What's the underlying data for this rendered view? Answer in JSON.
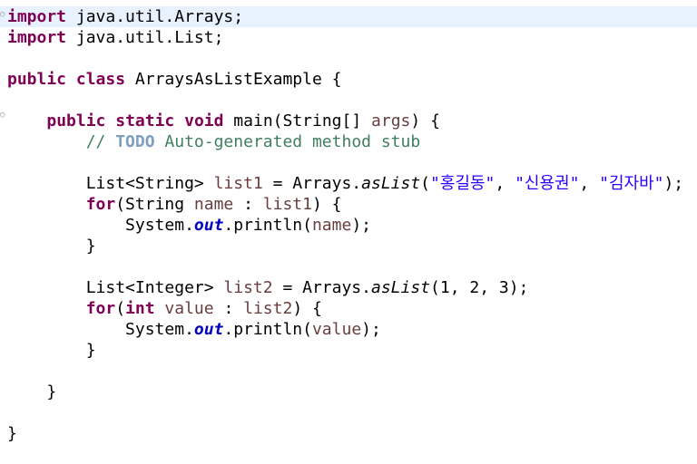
{
  "editor": {
    "lines": [
      {
        "tokens": [
          {
            "t": "kw",
            "v": "import"
          },
          {
            "t": "pl",
            "v": " java.util.Arrays;"
          }
        ]
      },
      {
        "tokens": [
          {
            "t": "kw",
            "v": "import"
          },
          {
            "t": "pl",
            "v": " java.util.List;"
          }
        ]
      },
      {
        "tokens": []
      },
      {
        "tokens": [
          {
            "t": "kw",
            "v": "public"
          },
          {
            "t": "pl",
            "v": " "
          },
          {
            "t": "kw",
            "v": "class"
          },
          {
            "t": "pl",
            "v": " ArraysAsListExample {"
          }
        ]
      },
      {
        "tokens": []
      },
      {
        "tokens": [
          {
            "t": "pl",
            "v": "    "
          },
          {
            "t": "kw",
            "v": "public"
          },
          {
            "t": "pl",
            "v": " "
          },
          {
            "t": "kw",
            "v": "static"
          },
          {
            "t": "pl",
            "v": " "
          },
          {
            "t": "kw",
            "v": "void"
          },
          {
            "t": "pl",
            "v": " main(String[] "
          },
          {
            "t": "var",
            "v": "args"
          },
          {
            "t": "pl",
            "v": ") {"
          }
        ]
      },
      {
        "tokens": [
          {
            "t": "cmt",
            "v": "        // "
          },
          {
            "t": "todo",
            "v": "TODO"
          },
          {
            "t": "cmt",
            "v": " Auto-generated method stub"
          }
        ]
      },
      {
        "tokens": []
      },
      {
        "tokens": [
          {
            "t": "pl",
            "v": "        List<String> "
          },
          {
            "t": "var",
            "v": "list1"
          },
          {
            "t": "pl",
            "v": " = Arrays."
          },
          {
            "t": "stm",
            "v": "asList"
          },
          {
            "t": "pl",
            "v": "("
          },
          {
            "t": "str",
            "v": "\"홍길동\""
          },
          {
            "t": "pl",
            "v": ", "
          },
          {
            "t": "str",
            "v": "\"신용권\""
          },
          {
            "t": "pl",
            "v": ", "
          },
          {
            "t": "str",
            "v": "\"김자바\""
          },
          {
            "t": "pl",
            "v": ");"
          }
        ]
      },
      {
        "tokens": [
          {
            "t": "pl",
            "v": "        "
          },
          {
            "t": "kw",
            "v": "for"
          },
          {
            "t": "pl",
            "v": "(String "
          },
          {
            "t": "var",
            "v": "name"
          },
          {
            "t": "pl",
            "v": " : "
          },
          {
            "t": "var",
            "v": "list1"
          },
          {
            "t": "pl",
            "v": ") {"
          }
        ]
      },
      {
        "tokens": [
          {
            "t": "pl",
            "v": "            System."
          },
          {
            "t": "fld",
            "v": "out"
          },
          {
            "t": "pl",
            "v": ".println("
          },
          {
            "t": "var",
            "v": "name"
          },
          {
            "t": "pl",
            "v": ");"
          }
        ]
      },
      {
        "tokens": [
          {
            "t": "pl",
            "v": "        }"
          }
        ]
      },
      {
        "tokens": []
      },
      {
        "tokens": [
          {
            "t": "pl",
            "v": "        List<Integer> "
          },
          {
            "t": "var",
            "v": "list2"
          },
          {
            "t": "pl",
            "v": " = Arrays."
          },
          {
            "t": "stm",
            "v": "asList"
          },
          {
            "t": "pl",
            "v": "(1, 2, 3);"
          }
        ]
      },
      {
        "tokens": [
          {
            "t": "pl",
            "v": "        "
          },
          {
            "t": "kw",
            "v": "for"
          },
          {
            "t": "pl",
            "v": "("
          },
          {
            "t": "kw",
            "v": "int"
          },
          {
            "t": "pl",
            "v": " "
          },
          {
            "t": "var",
            "v": "value"
          },
          {
            "t": "pl",
            "v": " : "
          },
          {
            "t": "var",
            "v": "list2"
          },
          {
            "t": "pl",
            "v": ") {"
          }
        ]
      },
      {
        "tokens": [
          {
            "t": "pl",
            "v": "            System."
          },
          {
            "t": "fld",
            "v": "out"
          },
          {
            "t": "pl",
            "v": ".println("
          },
          {
            "t": "var",
            "v": "value"
          },
          {
            "t": "pl",
            "v": ");"
          }
        ]
      },
      {
        "tokens": [
          {
            "t": "pl",
            "v": "        }"
          }
        ]
      },
      {
        "tokens": []
      },
      {
        "tokens": [
          {
            "t": "pl",
            "v": "    }"
          }
        ]
      },
      {
        "tokens": []
      },
      {
        "tokens": [
          {
            "t": "pl",
            "v": "}"
          }
        ]
      }
    ],
    "colors": {
      "keyword": "#7f0055",
      "comment": "#3f7f5f",
      "todo": "#7f9fbf",
      "string": "#2a00ff",
      "local_variable": "#6a3e3e",
      "static_field": "#0000c0",
      "current_line": "#e8f2fe"
    }
  }
}
